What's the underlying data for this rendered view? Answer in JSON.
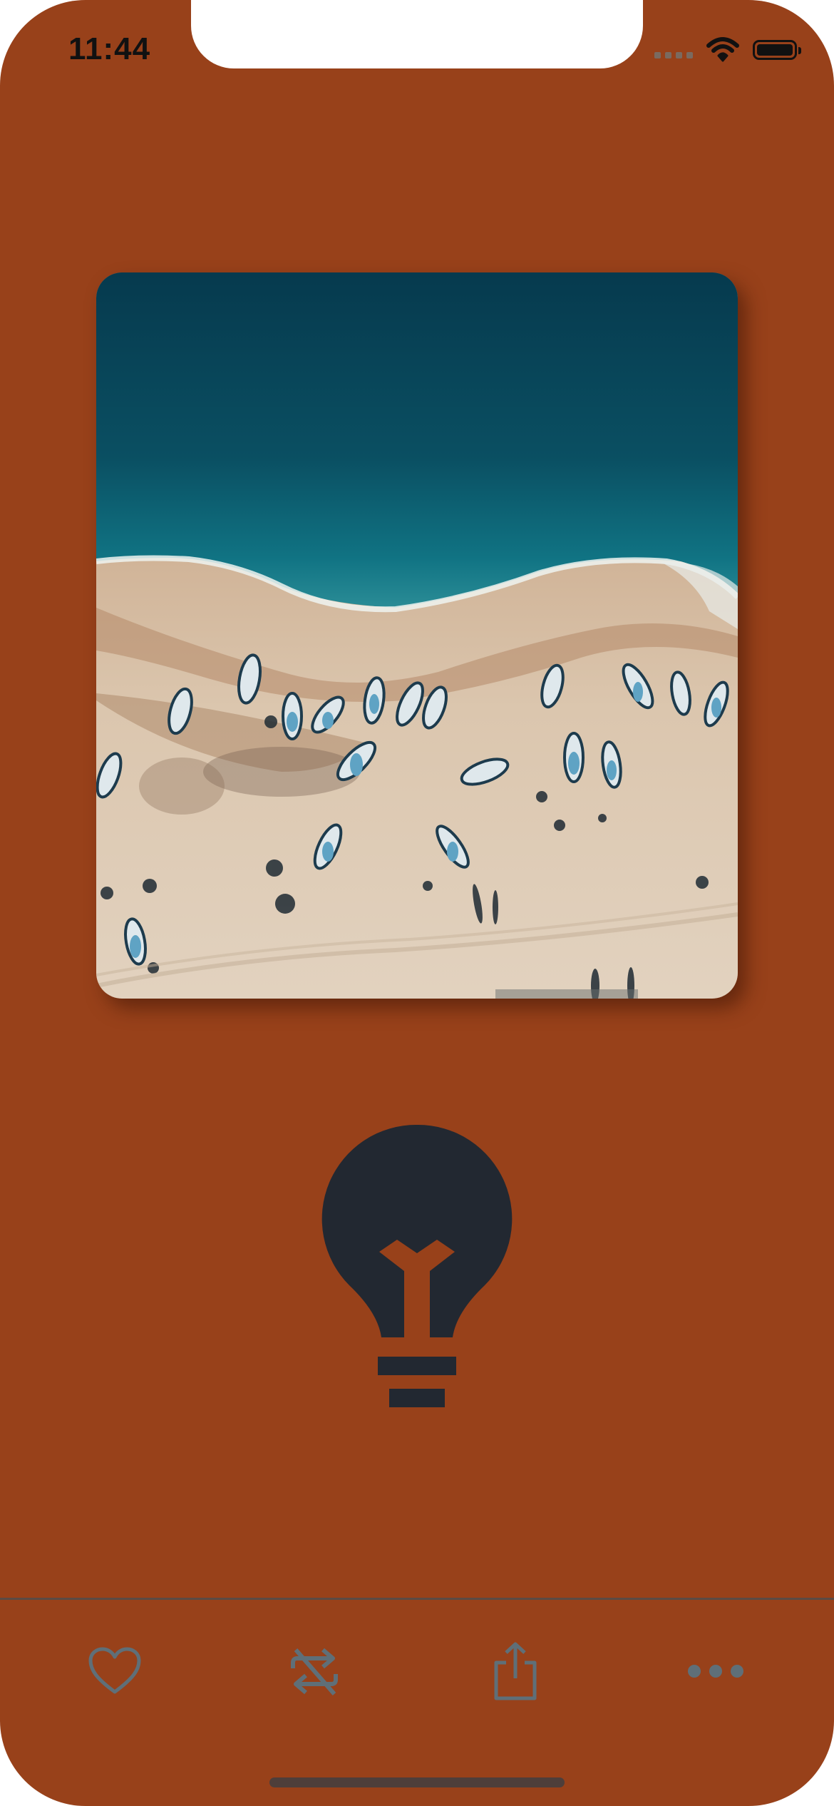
{
  "status_bar": {
    "time": "11:44"
  },
  "artwork": {
    "description_icon": "beach-boats-artwork"
  },
  "center_icon": "light-bulb-icon",
  "toolbar": {
    "buttons": [
      {
        "icon": "heart-icon"
      },
      {
        "icon": "repost-icon"
      },
      {
        "icon": "share-icon"
      },
      {
        "icon": "more-icon"
      }
    ]
  },
  "colors": {
    "background": "#98411a",
    "bulb": "#222831",
    "toolbar_icon": "#5f6f78"
  }
}
